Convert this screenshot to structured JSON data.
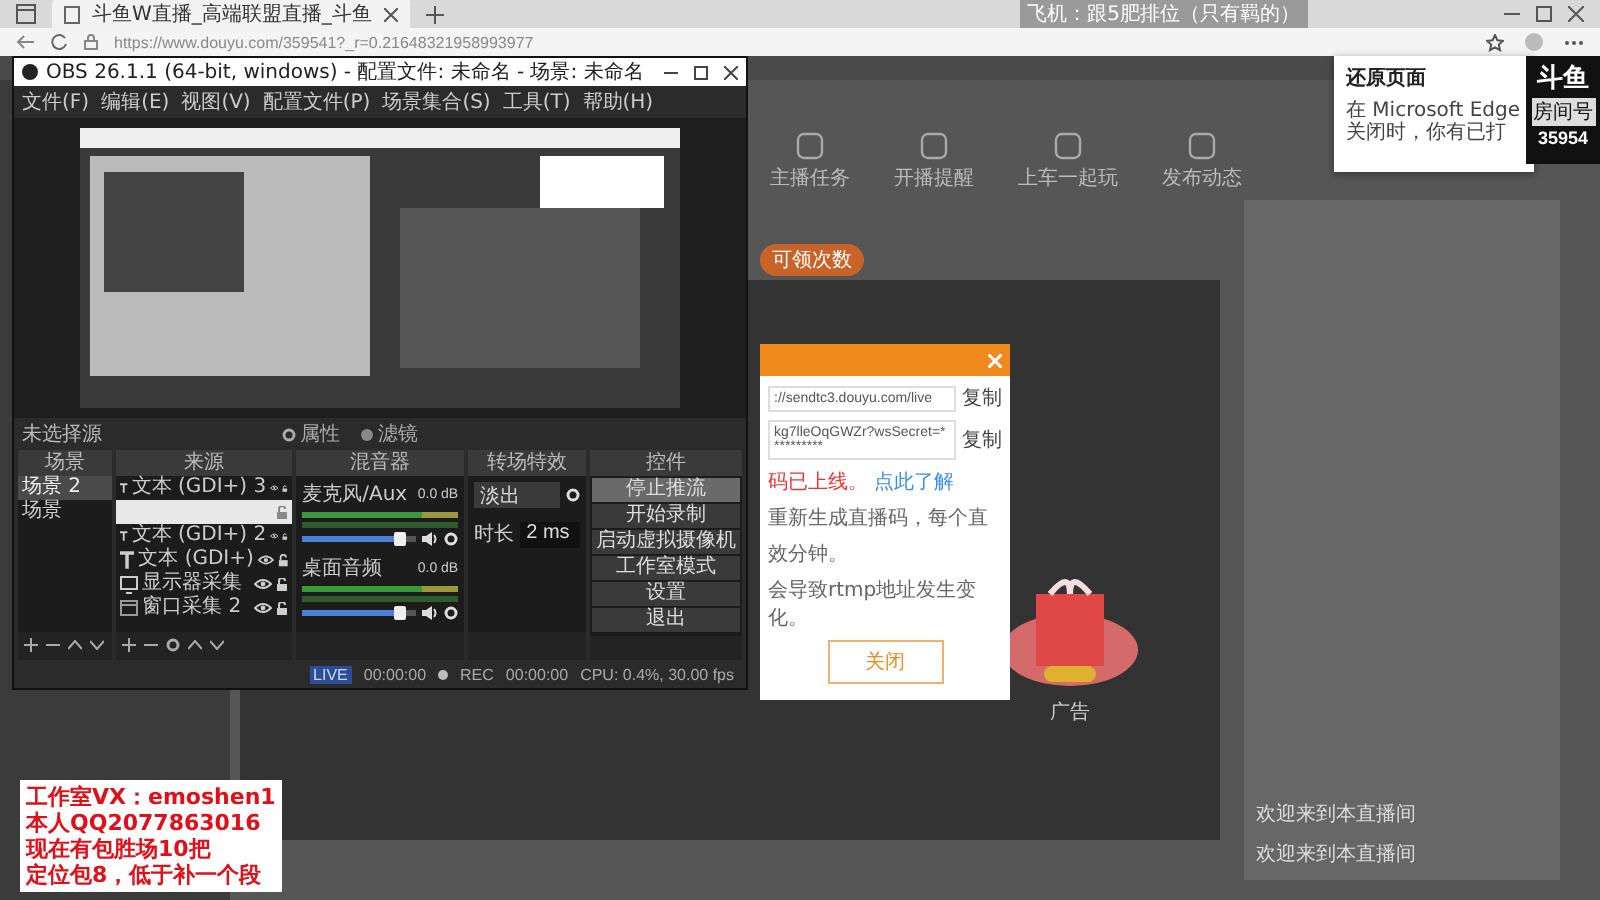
{
  "browser": {
    "tab_title": "斗鱼W直播_高端联盟直播_斗鱼",
    "url": "https://www.douyu.com/359541?_r=0.21648321958993977",
    "stream_title": "飞机：跟5肥排位（只有羁的）"
  },
  "page": {
    "nav_items": [
      "主播任务",
      "开播提醒",
      "上车一起玩",
      "发布动态"
    ],
    "claim_button": "可领次数",
    "ad_label": "广告",
    "chat": [
      "欢迎来到本直播间",
      "欢迎来到本直播间"
    ]
  },
  "dialog": {
    "fields": [
      {
        "value": "://sendtc3.douyu.com/live",
        "action": "复制"
      },
      {
        "value": "kg7lleOqGWZr?wsSecret=**********",
        "action": "复制"
      }
    ],
    "notice": "码已上线。",
    "notice_link": "点此了解",
    "info": [
      "重新生成直播码，每个直",
      "效分钟。",
      "会导致rtmp地址发生变化。"
    ],
    "close_button": "关闭"
  },
  "notification": {
    "title": "还原页面",
    "text": "在 Microsoft Edge 关闭时，你有已打"
  },
  "badge": {
    "logo": "斗鱼",
    "label": "房间号",
    "room": "35954"
  },
  "overlay_text": [
    "工作室VX：emoshen1",
    "本人QQ2077863016",
    "现在有包胜场10把",
    "定位包8，低于补一个段"
  ],
  "obs": {
    "title": "OBS 26.1.1 (64-bit, windows) - 配置文件: 未命名 - 场景: 未命名",
    "menu": [
      "文件(F)",
      "编辑(E)",
      "视图(V)",
      "配置文件(P)",
      "场景集合(S)",
      "工具(T)",
      "帮助(H)"
    ],
    "source_toolbar": {
      "label": "未选择源",
      "buttons": [
        "属性",
        "滤镜"
      ]
    },
    "scenes": {
      "title": "场景",
      "items": [
        {
          "label": "场景 2",
          "selected": true
        },
        {
          "label": "场景",
          "selected": false
        }
      ]
    },
    "sources": {
      "title": "来源",
      "items": [
        {
          "kind": "text",
          "label": "文本 (GDI+) 3",
          "selected": false
        },
        {
          "kind": "blank",
          "selected": true
        },
        {
          "kind": "text",
          "label": "文本 (GDI+) 2",
          "selected": false
        },
        {
          "kind": "text",
          "label": "文本 (GDI+)",
          "selected": false
        },
        {
          "kind": "monitor",
          "label": "显示器采集",
          "selected": false
        },
        {
          "kind": "window",
          "label": "窗口采集 2",
          "selected": false
        }
      ]
    },
    "mixer": {
      "title": "混音器",
      "channels": [
        {
          "name": "麦克风/Aux",
          "reading": "0.0 dB",
          "level": 0.85
        },
        {
          "name": "桌面音频",
          "reading": "0.0 dB",
          "level": 0.85
        }
      ]
    },
    "transitions": {
      "title": "转场特效",
      "transition": "淡出",
      "duration_label": "时长",
      "duration": "2 ms"
    },
    "controls": {
      "title": "控件",
      "buttons": [
        {
          "label": "停止推流",
          "selected": true
        },
        {
          "label": "开始录制",
          "selected": false
        },
        {
          "label": "启动虚拟摄像机",
          "selected": false
        },
        {
          "label": "工作室模式",
          "selected": false
        },
        {
          "label": "设置",
          "selected": false
        },
        {
          "label": "退出",
          "selected": false
        }
      ]
    },
    "status": {
      "live_label": "LIVE",
      "live_time": "00:00:00",
      "rec_label": "REC",
      "rec_time": "00:00:00",
      "cpu": "CPU: 0.4%, 30.00 fps"
    }
  }
}
